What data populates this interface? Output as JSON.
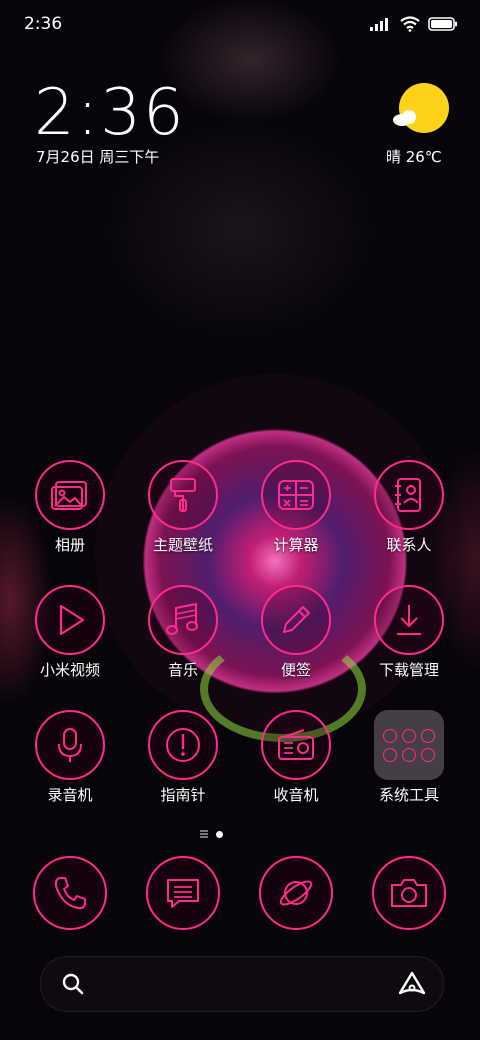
{
  "status_bar": {
    "time": "2:36"
  },
  "clock_widget": {
    "time": "2:36",
    "date": "7月26日 周三下午"
  },
  "weather_widget": {
    "text": "晴 26℃",
    "icon": "sunny-cloud-icon"
  },
  "apps": [
    {
      "label": "相册",
      "icon": "gallery-icon"
    },
    {
      "label": "主题壁纸",
      "icon": "theme-brush-icon"
    },
    {
      "label": "计算器",
      "icon": "calculator-icon"
    },
    {
      "label": "联系人",
      "icon": "contacts-icon"
    },
    {
      "label": "小米视频",
      "icon": "video-play-icon"
    },
    {
      "label": "音乐",
      "icon": "music-note-icon"
    },
    {
      "label": "便签",
      "icon": "notes-pencil-icon"
    },
    {
      "label": "下载管理",
      "icon": "download-icon"
    },
    {
      "label": "录音机",
      "icon": "microphone-icon"
    },
    {
      "label": "指南针",
      "icon": "compass-icon"
    },
    {
      "label": "收音机",
      "icon": "radio-icon"
    },
    {
      "label": "系统工具",
      "icon": "folder-icon"
    }
  ],
  "dock": [
    {
      "icon": "phone-icon"
    },
    {
      "icon": "message-icon"
    },
    {
      "icon": "browser-planet-icon"
    },
    {
      "icon": "camera-icon"
    }
  ],
  "page_indicator": {
    "pages": 2,
    "current": 2
  },
  "colors": {
    "accent": "#ff2a8a",
    "weather_sun": "#ffd21a"
  }
}
